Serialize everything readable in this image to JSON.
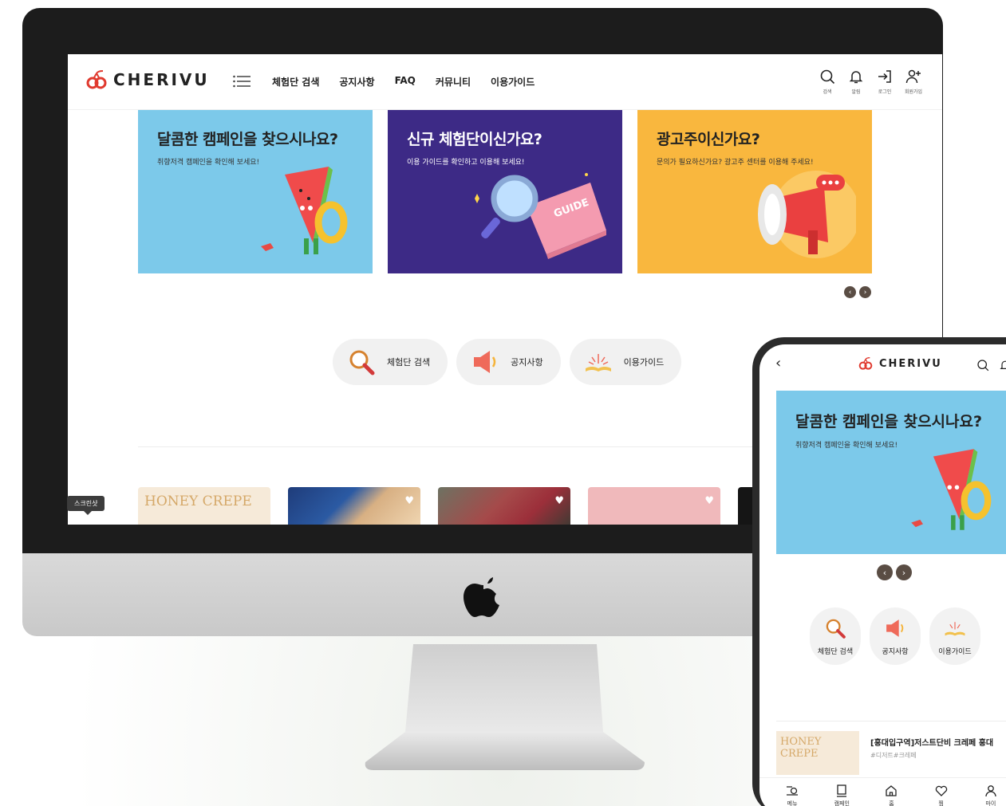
{
  "brand": {
    "name": "CHERIVU",
    "accent": "#e03a2f"
  },
  "desktop": {
    "nav": [
      "체험단 검색",
      "공지사항",
      "FAQ",
      "커뮤니티",
      "이용가이드"
    ],
    "utility": [
      {
        "icon": "search-icon",
        "label": "검색"
      },
      {
        "icon": "bell-icon",
        "label": "알림"
      },
      {
        "icon": "login-icon",
        "label": "로그인"
      },
      {
        "icon": "signup-icon",
        "label": "회원가입"
      }
    ],
    "banners": [
      {
        "title": "달콤한 캠페인을 찾으시나요?",
        "subtitle": "취향저격 캠페인을 확인해 보세요!",
        "color": "#7cc9ea",
        "illustration": "watermelon-character"
      },
      {
        "title": "신규 체험단이신가요?",
        "subtitle": "이용 가이드를 확인하고 이용해 보세요!",
        "color": "#3d2a86",
        "illustration": "magnifier-guide-book",
        "book_text": "GUIDE"
      },
      {
        "title": "광고주이신가요?",
        "subtitle": "문의가 필요하신가요? 광고주 센터를 이용해 주세요!",
        "color": "#f9b73e",
        "illustration": "megaphone"
      }
    ],
    "quick": [
      "체험단 검색",
      "공지사항",
      "이용가이드"
    ],
    "thumbs": [
      {
        "text": "HONEY CREPE"
      },
      {
        "text": ""
      },
      {
        "text": ""
      },
      {
        "text": ""
      },
      {
        "text": ""
      }
    ],
    "tooltip": "스크린샷"
  },
  "mobile": {
    "banner": {
      "title": "달콤한 캠페인을 찾으시나요?",
      "subtitle": "취향저격 캠페인을 확인해 보세요!"
    },
    "quick": [
      "체험단 검색",
      "공지사항",
      "이용가이드"
    ],
    "item": {
      "thumb_text": "HONEY CREPE",
      "title": "[홍대입구역]저스트단비 크레페 홍대",
      "tags": "#디저트#크레페"
    },
    "tabs": [
      "메뉴",
      "캠페인",
      "홈",
      "찜",
      "마이"
    ]
  }
}
